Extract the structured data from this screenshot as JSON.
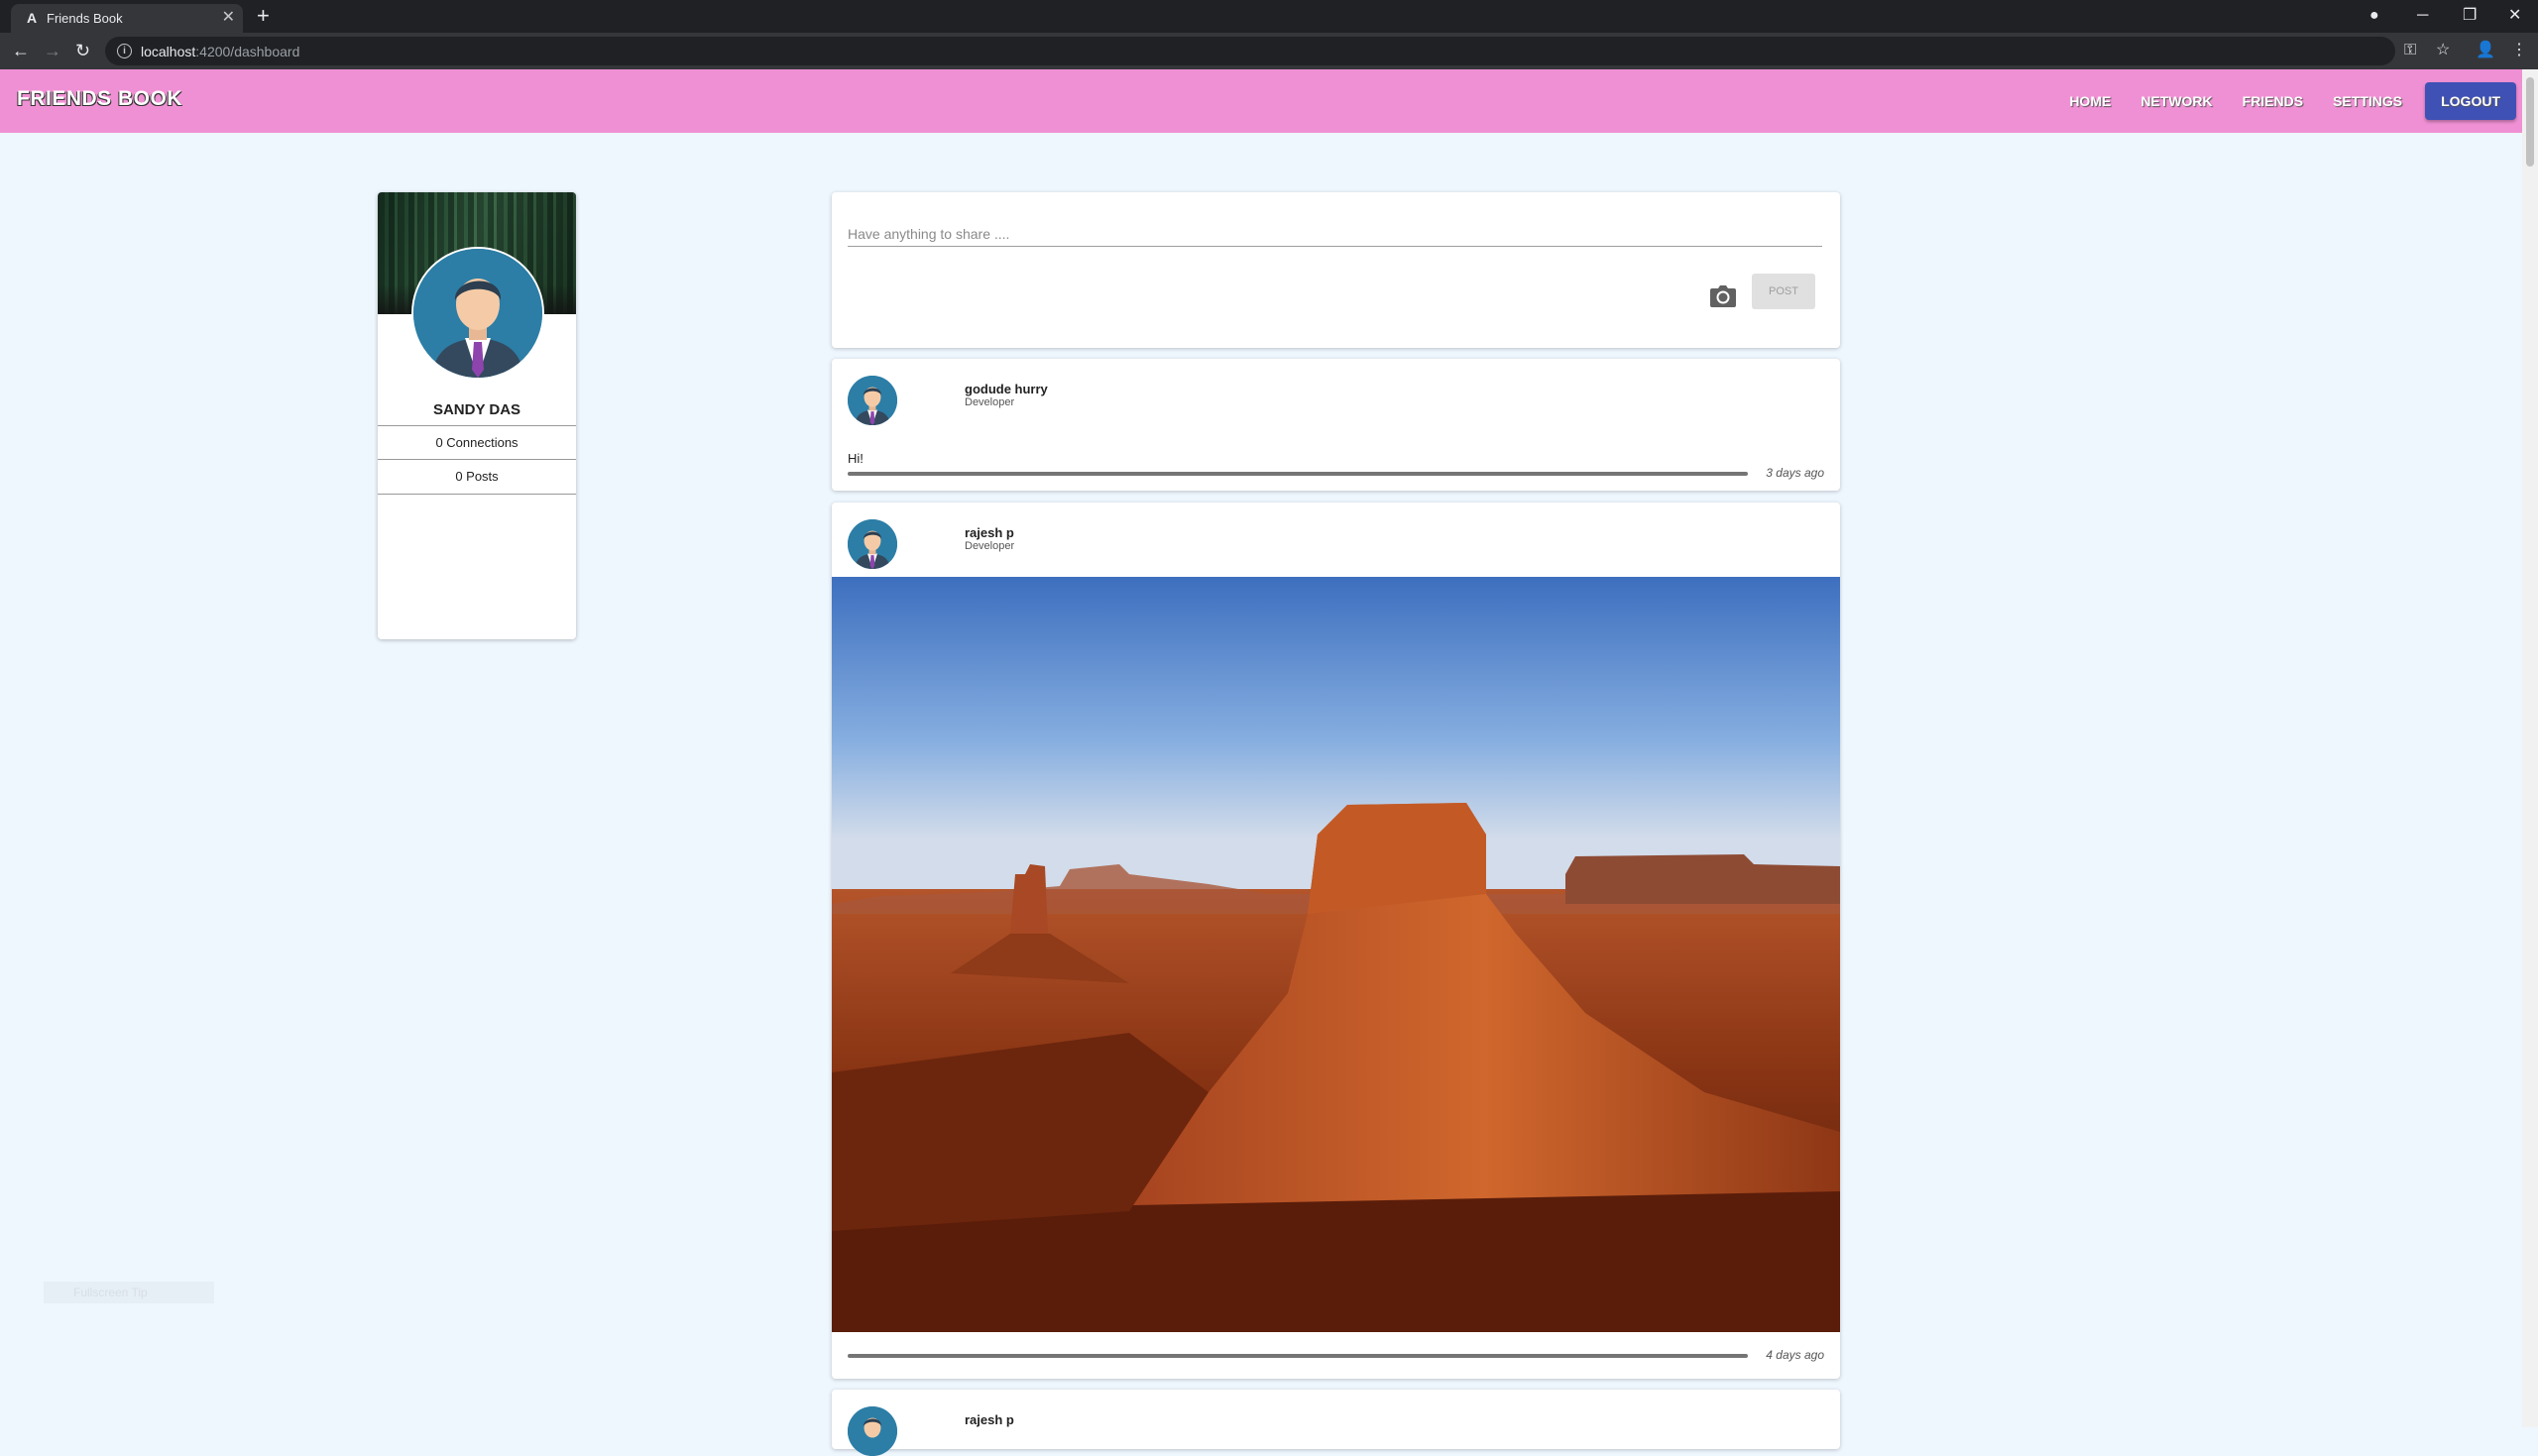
{
  "browser": {
    "tab_title": "Friends Book",
    "favicon": "A",
    "url_host": "localhost",
    "url_path": ":4200/dashboard"
  },
  "app": {
    "brand": "FRIENDS BOOK",
    "nav": [
      "HOME",
      "NETWORK",
      "FRIENDS",
      "SETTINGS"
    ],
    "logout_label": "LOGOUT",
    "header_color": "#f090d4",
    "accent": "#3f51b5"
  },
  "profile": {
    "name": "SANDY DAS",
    "connections": "0 Connections",
    "posts": "0 Posts"
  },
  "composer": {
    "placeholder": "Have anything to share ....",
    "post_label": "POST",
    "camera_icon": "camera-icon"
  },
  "posts": [
    {
      "author": "godude hurry",
      "role": "Developer",
      "text": "Hi!",
      "time": "3 days ago"
    },
    {
      "author": "rajesh p",
      "role": "Developer",
      "image": "desert-butte-photo",
      "time": "4 days ago"
    },
    {
      "author": "rajesh p"
    }
  ],
  "hint": "Fullscreen Tip"
}
